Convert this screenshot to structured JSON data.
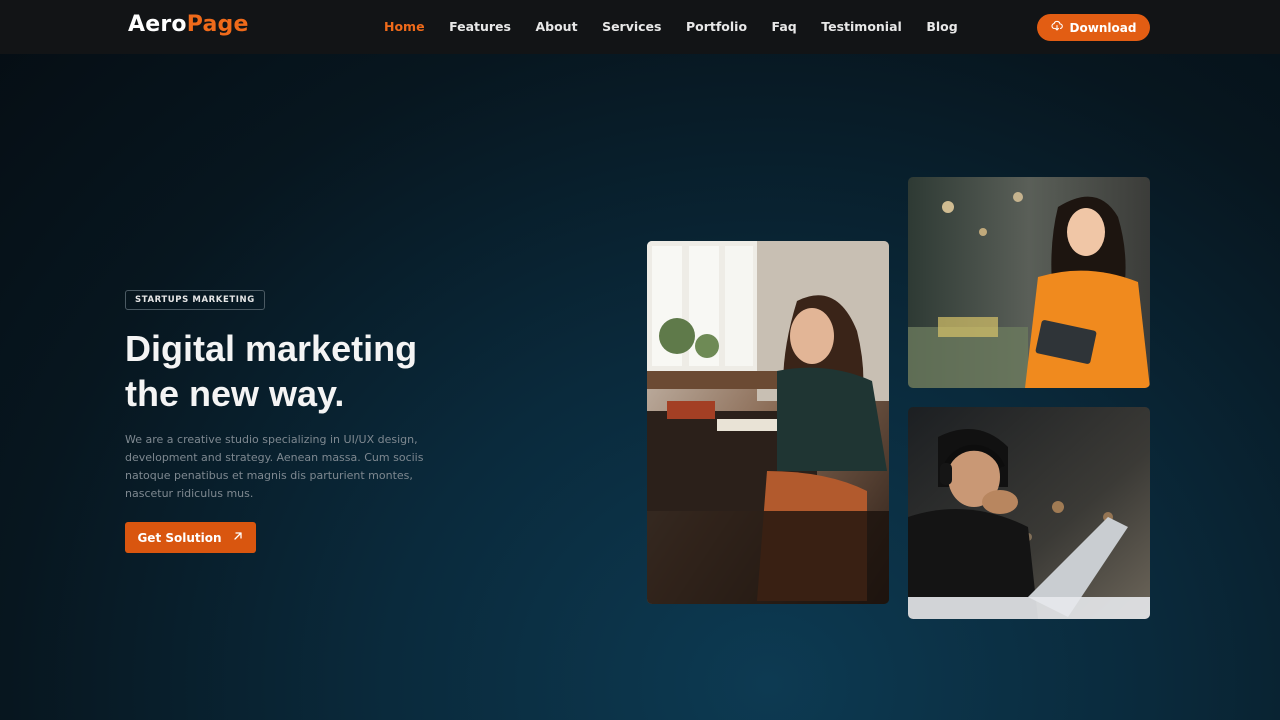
{
  "header": {
    "logo_part1": "Aero",
    "logo_part2": "Page",
    "nav": [
      "Home",
      "Features",
      "About",
      "Services",
      "Portfolio",
      "Faq",
      "Testimonial",
      "Blog"
    ],
    "active_nav": "Home",
    "download_label": "Download",
    "download_icon": "cloud-download-icon"
  },
  "hero": {
    "badge": "STARTUPS MARKETING",
    "headline_line1": "Digital marketing",
    "headline_line2": "the new way.",
    "description": "We are a creative studio specializing in UI/UX design, development and strategy. Aenean massa. Cum sociis natoque penatibus et magnis dis parturient montes, nascetur ridiculus mus.",
    "cta_label": "Get Solution",
    "cta_icon": "arrow-up-right-icon"
  },
  "colors": {
    "accent": "#ef6a1a",
    "header_bg": "#121416",
    "background": "#07161f"
  },
  "photos": [
    {
      "name": "woman-writing-at-desk-photo"
    },
    {
      "name": "woman-holding-tablet-photo"
    },
    {
      "name": "man-with-headphones-laptop-photo"
    }
  ]
}
